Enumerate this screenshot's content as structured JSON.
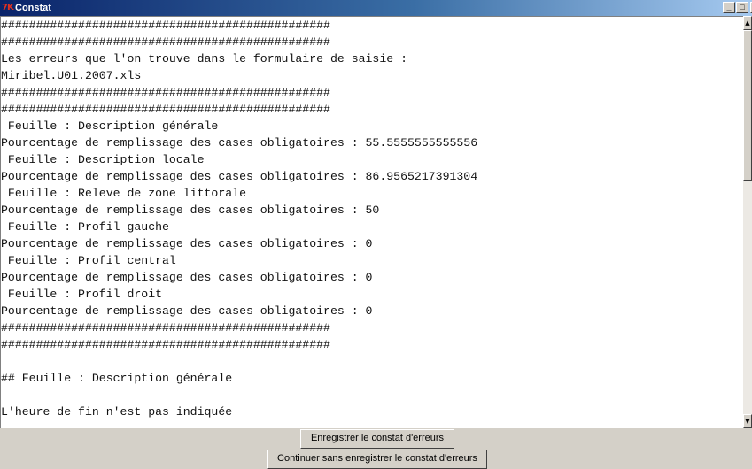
{
  "window": {
    "title": "Constat",
    "app_icon_text": "7K",
    "controls": {
      "minimize": "_",
      "maximize": "□",
      "close": "×"
    }
  },
  "report": {
    "lines": [
      "###############################################",
      "###############################################",
      "Les erreurs que l'on trouve dans le formulaire de saisie :",
      "Miribel.U01.2007.xls",
      "###############################################",
      "###############################################",
      " Feuille : Description générale",
      "Pourcentage de remplissage des cases obligatoires : 55.5555555555556",
      " Feuille : Description locale",
      "Pourcentage de remplissage des cases obligatoires : 86.9565217391304",
      " Feuille : Releve de zone littorale",
      "Pourcentage de remplissage des cases obligatoires : 50",
      " Feuille : Profil gauche",
      "Pourcentage de remplissage des cases obligatoires : 0",
      " Feuille : Profil central",
      "Pourcentage de remplissage des cases obligatoires : 0",
      " Feuille : Profil droit",
      "Pourcentage de remplissage des cases obligatoires : 0",
      "###############################################",
      "###############################################",
      "",
      "## Feuille : Description générale",
      "",
      "L'heure de fin n'est pas indiquée"
    ]
  },
  "buttons": {
    "save_label": "Enregistrer le constat d'erreurs",
    "continue_label": "Continuer sans enregistrer le constat d'erreurs"
  }
}
